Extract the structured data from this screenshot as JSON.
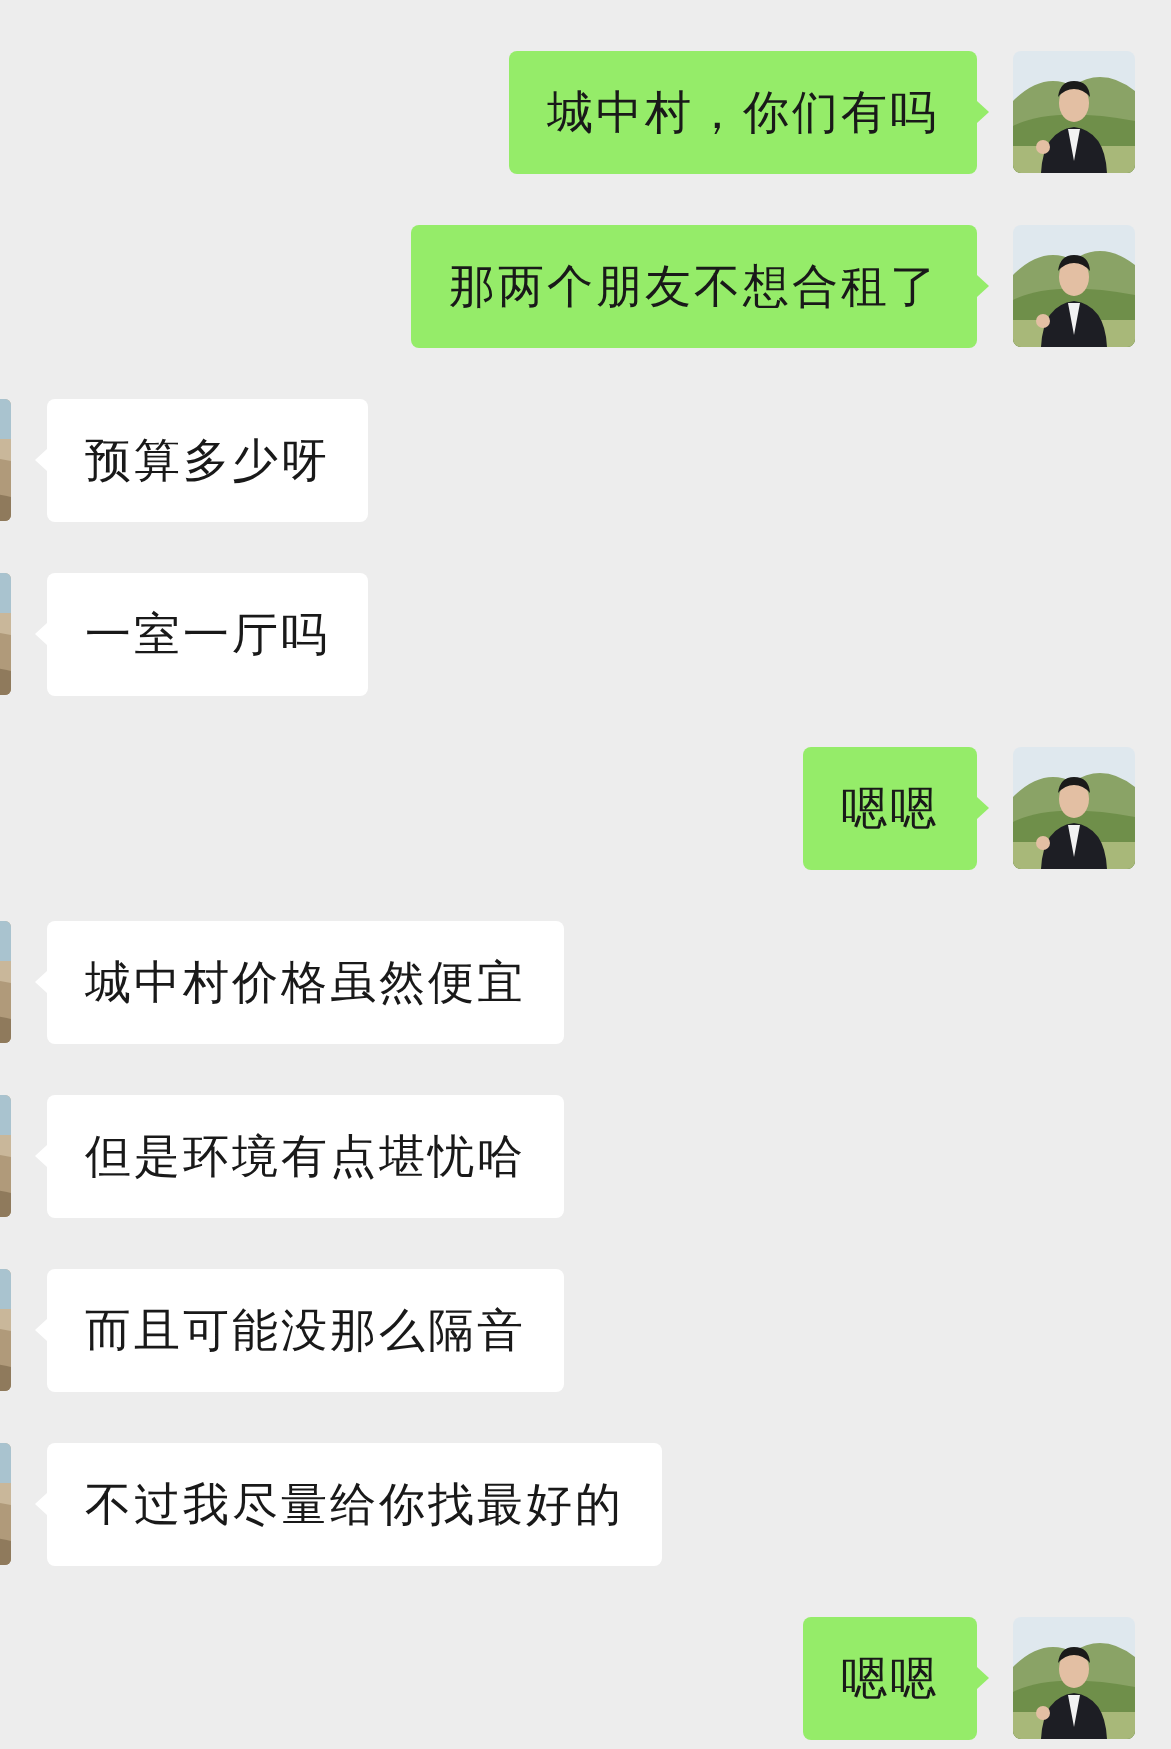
{
  "messages": [
    {
      "kind": "sent",
      "text": "城中村，你们有吗"
    },
    {
      "kind": "sent",
      "text": "那两个朋友不想合租了"
    },
    {
      "kind": "received",
      "text": "预算多少呀"
    },
    {
      "kind": "received",
      "text": "一室一厅吗"
    },
    {
      "kind": "sent",
      "text": "嗯嗯"
    },
    {
      "kind": "received",
      "text": "城中村价格虽然便宜"
    },
    {
      "kind": "received",
      "text": "但是环境有点堪忧哈"
    },
    {
      "kind": "received",
      "text": "而且可能没那么隔音"
    },
    {
      "kind": "received",
      "text": "不过我尽量给你找最好的"
    },
    {
      "kind": "sent",
      "text": "嗯嗯"
    }
  ]
}
